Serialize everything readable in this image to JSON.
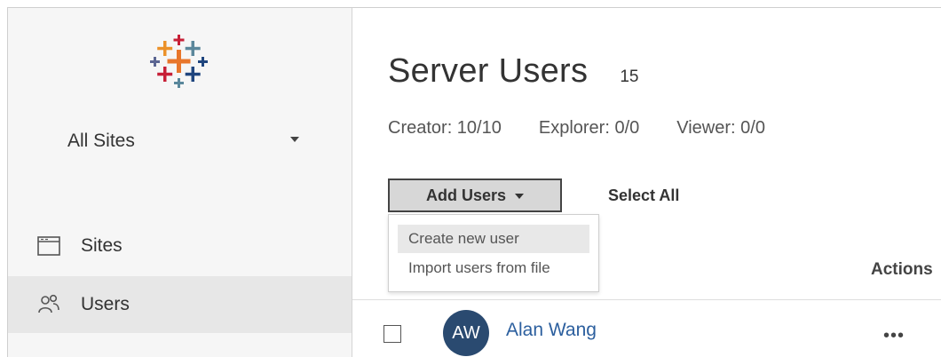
{
  "sidebar": {
    "logo_icon": "tableau-logo-icon",
    "site_selector": {
      "label": "All Sites",
      "icon": "caret-down-icon"
    },
    "items": [
      {
        "label": "Sites",
        "icon": "browser-window-icon",
        "selected": false
      },
      {
        "label": "Users",
        "icon": "users-icon",
        "selected": true
      }
    ]
  },
  "main": {
    "title": "Server Users",
    "count": "15",
    "licenses": {
      "creator": "Creator: 10/10",
      "explorer": "Explorer: 0/0",
      "viewer": "Viewer: 0/0"
    },
    "add_users_label": "Add Users",
    "select_all_label": "Select All",
    "dropdown": {
      "items": [
        "Create new user",
        "Import users from file"
      ],
      "highlighted_index": 0
    },
    "actions_header": "Actions",
    "rows": [
      {
        "initials": "AW",
        "name": "Alan Wang",
        "actions": "•••"
      }
    ]
  },
  "colors": {
    "sidebar_bg": "#f6f6f6",
    "selected_nav_bg": "#e7e7e7",
    "link": "#2c5f9e",
    "avatar_bg": "#2a4a70",
    "button_bg": "#d7d7d7"
  }
}
